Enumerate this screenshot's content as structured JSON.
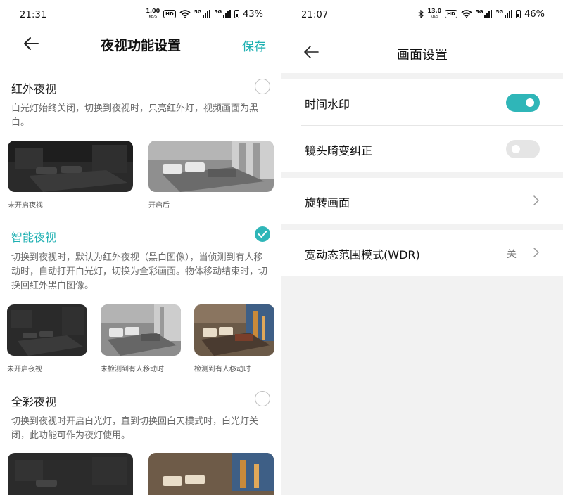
{
  "left": {
    "status": {
      "time": "21:31",
      "netspeed": "1.00",
      "netspeed_unit": "KB/S",
      "hd": "HD",
      "sig1": "5G",
      "sig2": "5G",
      "battery": "43%"
    },
    "header": {
      "title": "夜视功能设置",
      "save_label": "保存"
    },
    "modes": [
      {
        "title": "红外夜视",
        "checked": false,
        "description": "白光灯始终关闭，切换到夜视时，只亮红外灯，视频画面为黑白。",
        "captions": [
          "未开启夜视",
          "开启后"
        ]
      },
      {
        "title": "智能夜视",
        "checked": true,
        "description": "切换到夜视时，默认为红外夜视（黑白图像），当侦测到有人移动时，自动打开白光灯，切换为全彩画面。物体移动结束时，切换回红外黑白图像。",
        "captions": [
          "未开启夜视",
          "未检测到有人移动时",
          "检测到有人移动时"
        ]
      },
      {
        "title": "全彩夜视",
        "checked": false,
        "description": "切换到夜视时开启白光灯，直到切换回白天模式时，白光灯关闭，此功能可作为夜灯使用。",
        "captions": []
      }
    ]
  },
  "right": {
    "status": {
      "time": "21:07",
      "netspeed": "13.0",
      "netspeed_unit": "KB/S",
      "hd": "HD",
      "sig1": "5G",
      "sig2": "5G",
      "battery": "46%"
    },
    "header": {
      "title": "画面设置"
    },
    "settings": {
      "watermark": {
        "label": "时间水印",
        "on": true
      },
      "distortion": {
        "label": "镜头畸变纠正",
        "on": false
      },
      "rotate": {
        "label": "旋转画面"
      },
      "wdr": {
        "label": "宽动态范围模式(WDR)",
        "value": "关"
      }
    }
  },
  "colors": {
    "accent": "#2fb6b8",
    "accent_text": "#1fb0b2",
    "bg_gray": "#f2f2f2"
  },
  "icons": [
    "back-arrow-icon",
    "checkmark-icon",
    "chevron-right-icon",
    "wifi-icon",
    "bluetooth-icon",
    "battery-icon",
    "signal-icon"
  ]
}
